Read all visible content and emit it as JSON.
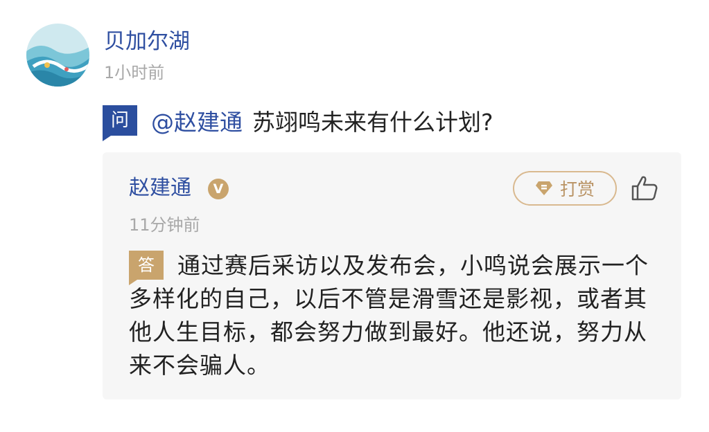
{
  "post": {
    "username": "贝加尔湖",
    "time": "1小时前"
  },
  "question": {
    "badge": "问",
    "mention": "@赵建通",
    "text": "苏翊鸣未来有什么计划?"
  },
  "answer": {
    "name": "赵建通",
    "verified_badge": "V",
    "tip_label": "打赏",
    "time": "11分钟前",
    "badge": "答",
    "text": "通过赛后采访以及发布会，小鸣说会展示一个多样化的自己，以后不管是滑雪还是影视，或者其他人生目标，都会努力做到最好。他还说，努力从来不会骗人。"
  },
  "colors": {
    "link_blue": "#2f4fa1",
    "question_badge": "#2b4e9e",
    "answer_gold": "#c9a46d",
    "card_bg": "#f6f6f6"
  },
  "icons": {
    "avatar": "avatar-ocean-wave",
    "tip": "diamond-icon",
    "like": "thumbs-up-icon"
  }
}
